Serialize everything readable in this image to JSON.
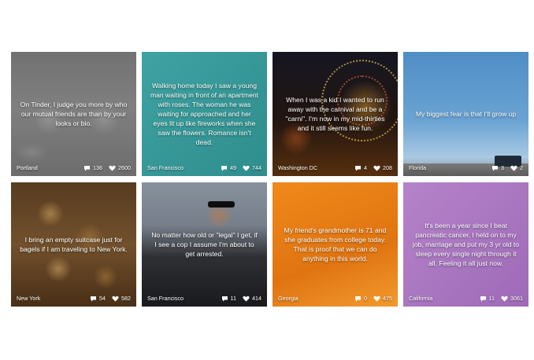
{
  "cards": [
    {
      "text": "On Tinder, I judge you more by who our mutual friends are than by your looks or bio.",
      "location": "Portland",
      "comments": "136",
      "likes": "2600"
    },
    {
      "text": "Walking home today I saw a young man waiting in front of an apartment with roses. The woman he was waiting for approached and her eyes lit up like fireworks when she saw the flowers. Romance isn't dead.",
      "location": "San Francisco",
      "comments": "49",
      "likes": "744"
    },
    {
      "text": "When I was a kid I wanted to run away with the carnival and be a \"carni\". I'm now in my mid-thirties and it still seems like fun.",
      "location": "Washington DC",
      "comments": "4",
      "likes": "208"
    },
    {
      "text": "My biggest fear is that I'll grow up",
      "location": "Florida",
      "comments": "3",
      "likes": "2"
    },
    {
      "text": "I bring an empty suitcase just for bagels if I am traveling to New York.",
      "location": "New York",
      "comments": "54",
      "likes": "582"
    },
    {
      "text": "No matter how old or \"legal\" I get, if I see a cop I assume I'm about to get arrested.",
      "location": "San Francisco",
      "comments": "11",
      "likes": "414"
    },
    {
      "text": "My friend's grandmother is 71 and she graduates from college today. That is proof that we can do anything in this world.",
      "location": "Georgia",
      "comments": "0",
      "likes": "475"
    },
    {
      "text": "It's been a year since I beat pancreatic cancer. I held on to my job, marriage and put my 3 yr old to sleep every single night through it all. Feeling it all just now.",
      "location": "California",
      "comments": "11",
      "likes": "3061"
    }
  ],
  "icons": {
    "comment": "speech-bubble-icon",
    "like": "heart-icon"
  }
}
